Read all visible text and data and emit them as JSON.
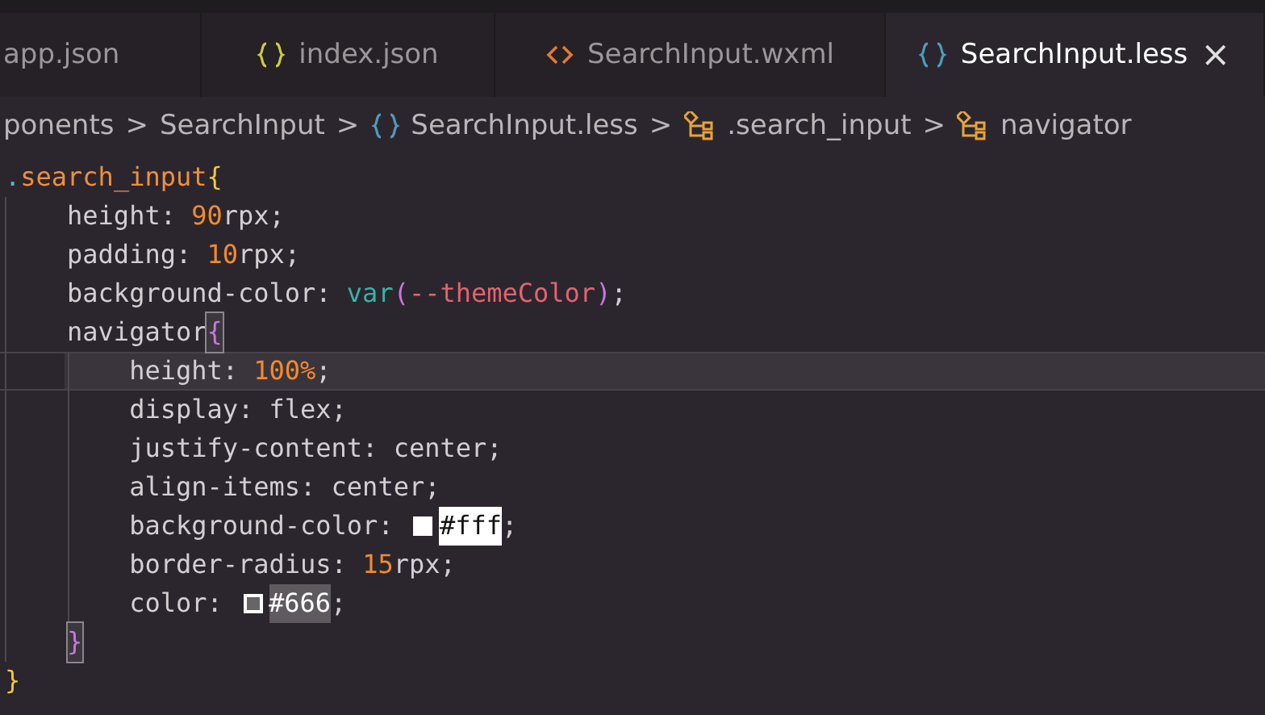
{
  "tabs": [
    {
      "label": "app.json",
      "kind": "plain",
      "selected": false,
      "closable": false
    },
    {
      "label": "index.json",
      "kind": "json",
      "selected": false,
      "closable": false
    },
    {
      "label": "SearchInput.wxml",
      "kind": "markup",
      "selected": false,
      "closable": false
    },
    {
      "label": "SearchInput.less",
      "kind": "json",
      "selected": true,
      "closable": true,
      "close_label": "×"
    }
  ],
  "breadcrumb": [
    {
      "label": "ponents",
      "kind": "folder"
    },
    {
      "label": "SearchInput",
      "kind": "folder"
    },
    {
      "label": "SearchInput.less",
      "kind": "file"
    },
    {
      "label": ".search_input",
      "kind": "symbol"
    },
    {
      "label": "navigator",
      "kind": "symbol"
    }
  ],
  "breadcrumb_separator": ">",
  "code": [
    {
      "kind": "outer",
      "highlighted": false,
      "tokens": [
        {
          "kind": "dot",
          "text": "."
        },
        {
          "kind": "selector",
          "text": "search_input"
        },
        {
          "kind": "brace",
          "text": "{"
        }
      ]
    },
    {
      "kind": "inner",
      "highlighted": false,
      "tokens": [
        {
          "kind": "plain",
          "text": "height: "
        },
        {
          "kind": "number",
          "text": "90"
        },
        {
          "kind": "plain",
          "text": "rpx;"
        }
      ]
    },
    {
      "kind": "inner",
      "highlighted": false,
      "tokens": [
        {
          "kind": "plain",
          "text": "padding: "
        },
        {
          "kind": "number",
          "text": "10"
        },
        {
          "kind": "plain",
          "text": "rpx;"
        }
      ]
    },
    {
      "kind": "inner",
      "highlighted": false,
      "tokens": [
        {
          "kind": "plain",
          "text": "background-color: "
        },
        {
          "kind": "func",
          "text": "var"
        },
        {
          "kind": "paren",
          "text": "("
        },
        {
          "kind": "variable",
          "text": "--themeColor"
        },
        {
          "kind": "paren",
          "text": ")"
        },
        {
          "kind": "plain",
          "text": ";"
        }
      ]
    },
    {
      "kind": "inner",
      "highlighted": false,
      "tokens": [
        {
          "kind": "plain",
          "text": "navigator"
        },
        {
          "kind": "match",
          "text": "{"
        }
      ]
    },
    {
      "kind": "deep",
      "highlighted": true,
      "tokens": [
        {
          "kind": "plain",
          "text": "height: "
        },
        {
          "kind": "number",
          "text": "100%"
        },
        {
          "kind": "plain",
          "text": ";"
        }
      ]
    },
    {
      "kind": "deep",
      "highlighted": false,
      "tokens": [
        {
          "kind": "plain",
          "text": "display: flex;"
        }
      ]
    },
    {
      "kind": "deep",
      "highlighted": false,
      "tokens": [
        {
          "kind": "plain",
          "text": "justify-content: center;"
        }
      ]
    },
    {
      "kind": "deep",
      "highlighted": false,
      "tokens": [
        {
          "kind": "plain",
          "text": "align-items: center;"
        }
      ]
    },
    {
      "kind": "deep",
      "highlighted": false,
      "tokens": [
        {
          "kind": "plain",
          "text": "background-color: "
        },
        {
          "kind": "swatch",
          "color": "#ffffff"
        },
        {
          "kind": "find",
          "text": "#fff"
        },
        {
          "kind": "plain",
          "text": ";"
        }
      ]
    },
    {
      "kind": "deep",
      "highlighted": false,
      "tokens": [
        {
          "kind": "plain",
          "text": "border-radius: "
        },
        {
          "kind": "number",
          "text": "15"
        },
        {
          "kind": "plain",
          "text": "rpx;"
        }
      ]
    },
    {
      "kind": "deep",
      "highlighted": false,
      "tokens": [
        {
          "kind": "plain",
          "text": "color: "
        },
        {
          "kind": "swatch",
          "color": "#666666"
        },
        {
          "kind": "selection",
          "text": "#666"
        },
        {
          "kind": "plain",
          "text": ";"
        }
      ]
    },
    {
      "kind": "inner",
      "highlighted": false,
      "tokens": [
        {
          "kind": "match",
          "text": "}"
        }
      ]
    },
    {
      "kind": "outer",
      "highlighted": false,
      "tokens": [
        {
          "kind": "brace",
          "text": "}"
        }
      ]
    }
  ]
}
